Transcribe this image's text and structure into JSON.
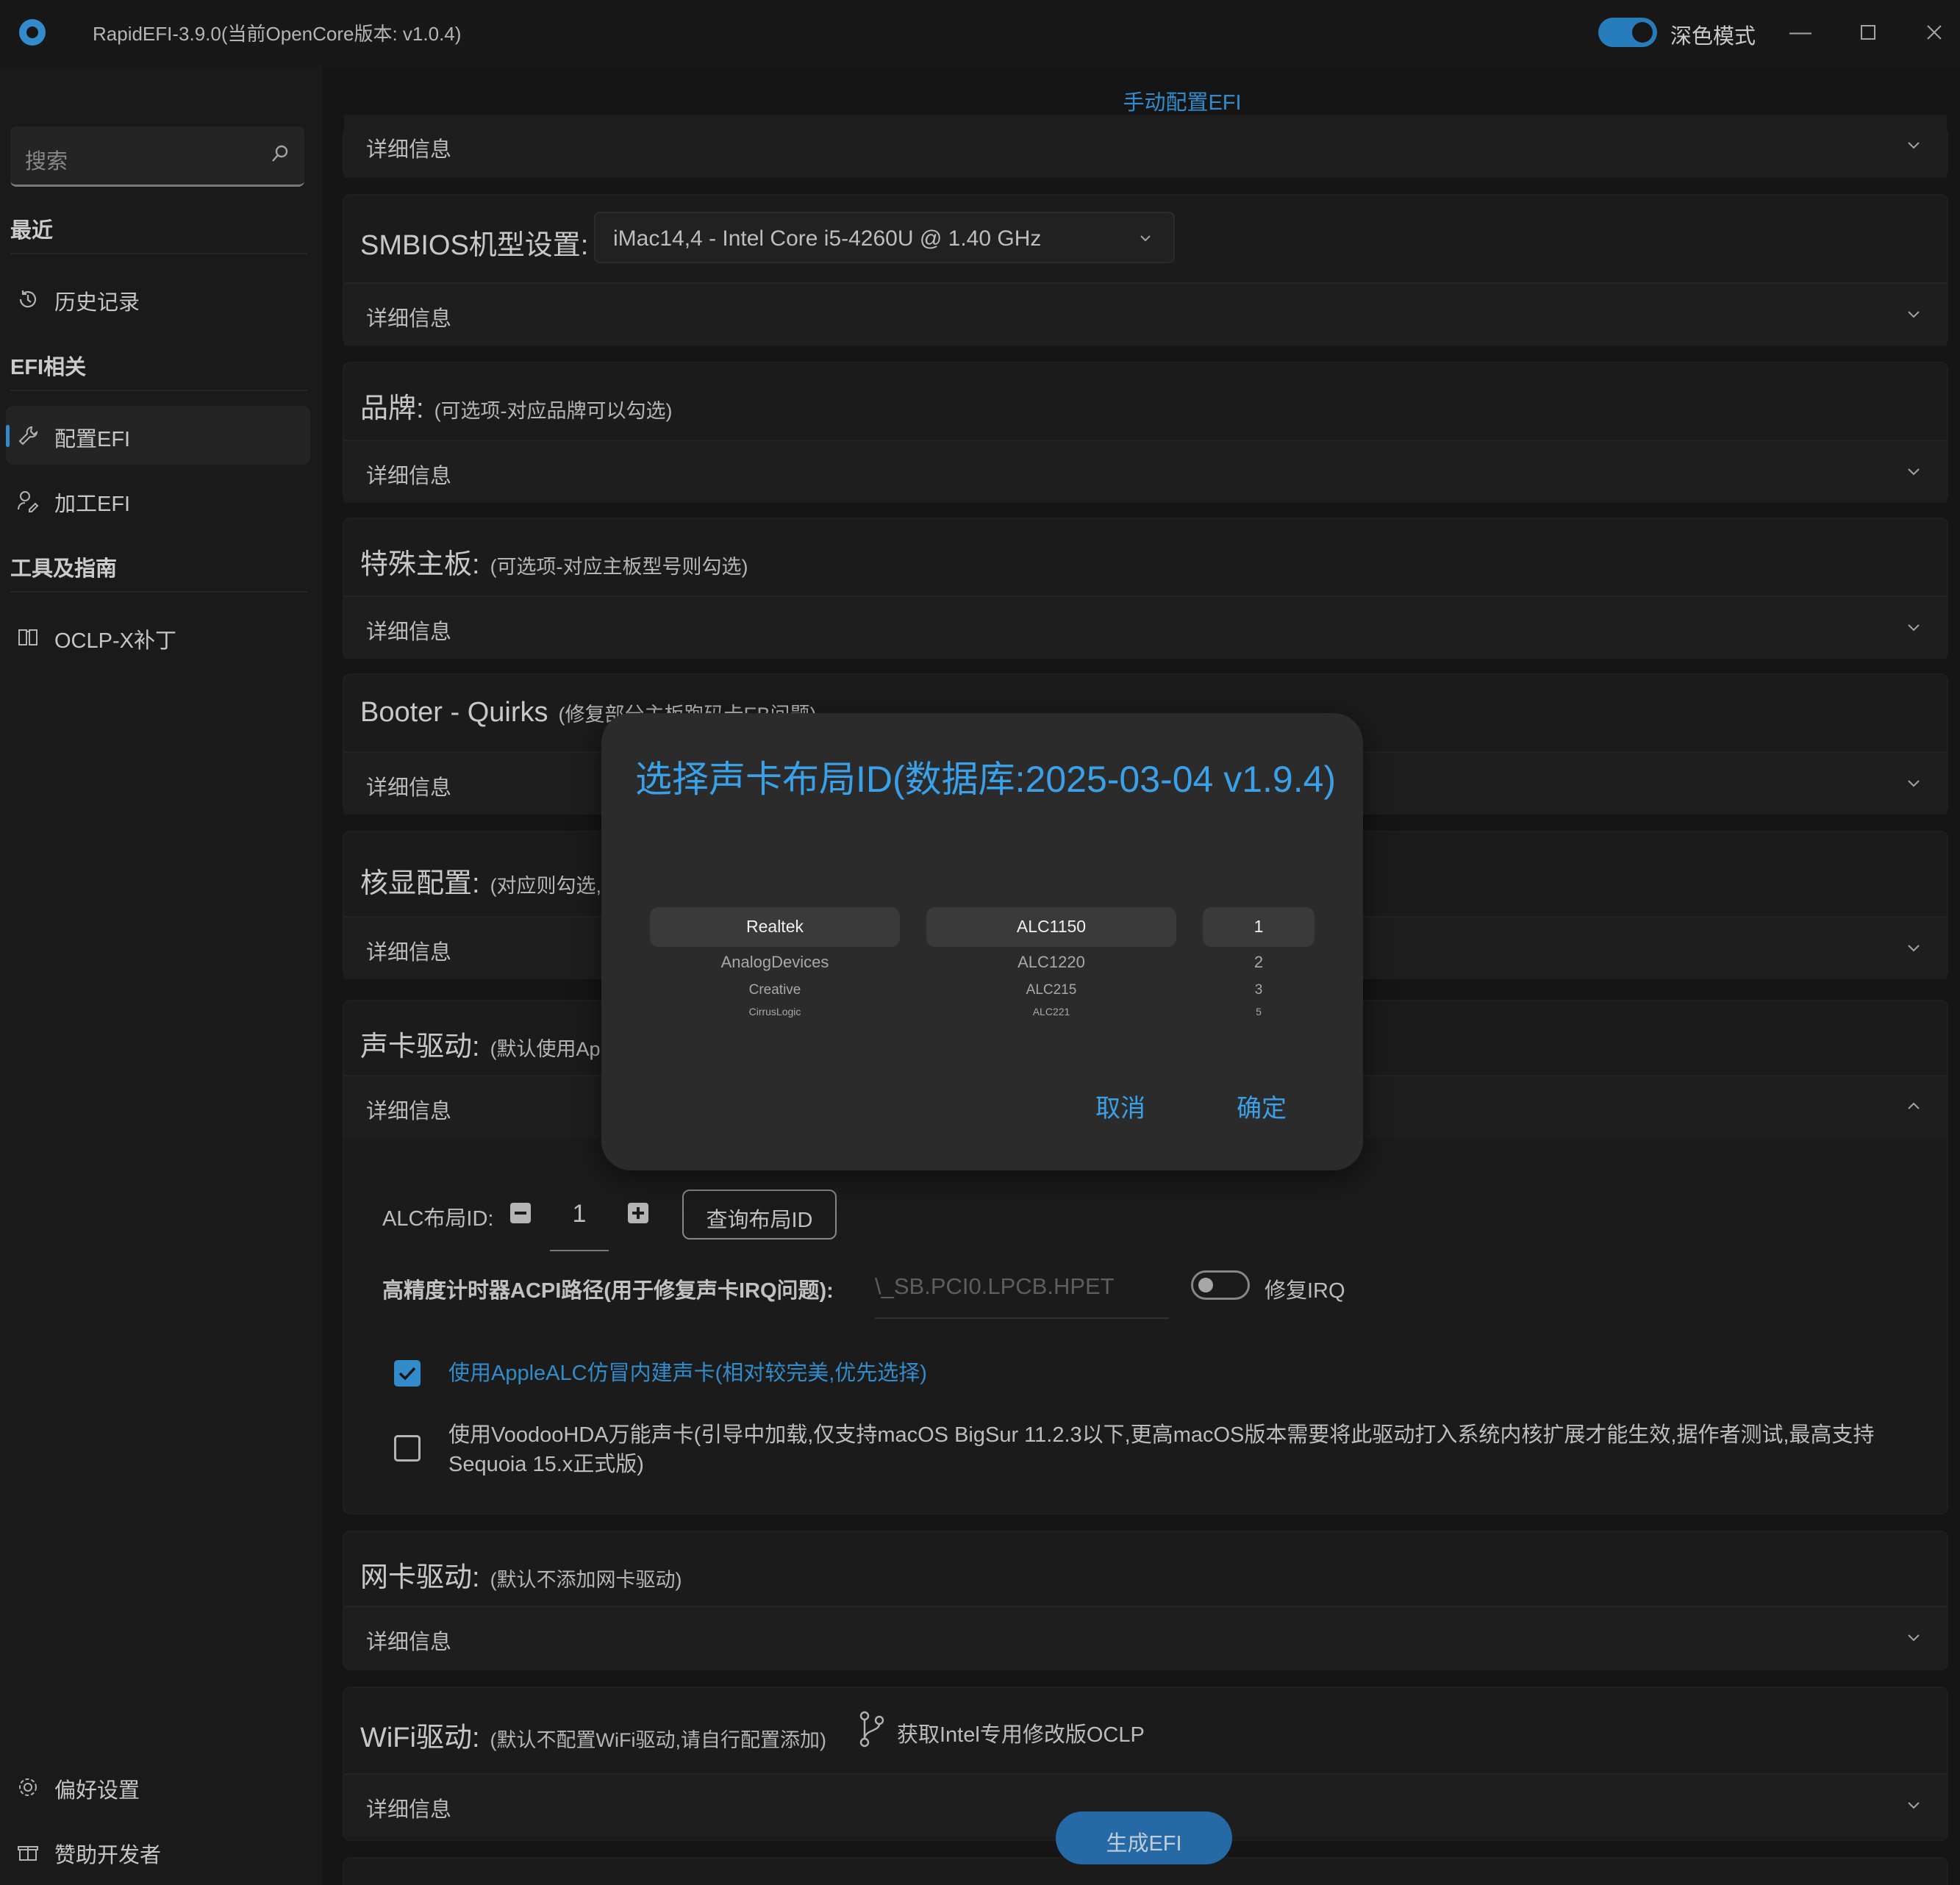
{
  "app": {
    "title": "RapidEFI-3.9.0(当前OpenCore版本: v1.0.4)",
    "dark_mode_label": "深色模式"
  },
  "sidebar": {
    "search_placeholder": "搜索",
    "sections": {
      "recent": "最近",
      "efi": "EFI相关",
      "tools": "工具及指南"
    },
    "items": {
      "history": "历史记录",
      "config_efi": "配置EFI",
      "process_efi": "加工EFI",
      "oclp": "OCLP-X补丁",
      "prefs": "偏好设置",
      "sponsor": "赞助开发者"
    }
  },
  "tab": {
    "label": "手动配置EFI"
  },
  "detail_label": "详细信息",
  "cards": {
    "smbios": {
      "title": "SMBIOS机型设置:",
      "value": "iMac14,4 - Intel Core i5-4260U @ 1.40 GHz"
    },
    "brand": {
      "title": "品牌:",
      "sub": "(可选项-对应品牌可以勾选)"
    },
    "board": {
      "title": "特殊主板:",
      "sub": "(可选项-对应主板型号则勾选)"
    },
    "booter": {
      "title": "Booter - Quirks",
      "sub": "(修复部分主板跑码卡EB问题)"
    },
    "igpu": {
      "title": "核显配置:",
      "sub": "(对应则勾选,不"
    },
    "audio": {
      "title": "声卡驱动:",
      "sub": "(默认使用Ap",
      "alc_label": "ALC布局ID:",
      "alc_value": "1",
      "query_btn": "查询布局ID",
      "hpet_label": "高精度计时器ACPI路径(用于修复声卡IRQ问题):",
      "hpet_value": "\\_SB.PCI0.LPCB.HPET",
      "irq_label": "修复IRQ",
      "opt1": "使用AppleALC仿冒内建声卡(相对较完美,优先选择)",
      "opt2": "使用VoodooHDA万能声卡(引导中加载,仅支持macOS BigSur 11.2.3以下,更高macOS版本需要将此驱动打入系统内核扩展才能生效,据作者测试,最高支持Sequoia 15.x正式版)"
    },
    "nic": {
      "title": "网卡驱动:",
      "sub": "(默认不添加网卡驱动)"
    },
    "wifi": {
      "title": "WiFi驱动:",
      "sub": "(默认不配置WiFi驱动,请自行配置添加)",
      "link": "获取Intel专用修改版OCLP"
    }
  },
  "generate_btn": "生成EFI",
  "dialog": {
    "title": "选择声卡布局ID(数据库:2025-03-04 v1.9.4)",
    "vendors": [
      "Realtek",
      "AnalogDevices",
      "Creative",
      "CirrusLogic"
    ],
    "codecs": [
      "ALC1150",
      "ALC1220",
      "ALC215",
      "ALC221"
    ],
    "ids": [
      "1",
      "2",
      "3",
      "5"
    ],
    "cancel": "取消",
    "ok": "确定"
  },
  "colors": {
    "accent": "#3aa0e8",
    "bg": "#181818",
    "card": "#1f1f1f"
  },
  "icons": [
    "search-icon",
    "history-icon",
    "wrench-icon",
    "tool-icon",
    "book-icon",
    "gear-icon",
    "gift-icon",
    "git-branch-icon",
    "chevron-down-icon",
    "chevron-up-icon"
  ]
}
